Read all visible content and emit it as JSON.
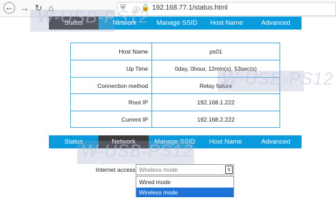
{
  "browser": {
    "url": "192.168.77.1/status.html"
  },
  "watermark": "W-USB-PS12",
  "top_tabs": [
    {
      "label": "Status",
      "active": true
    },
    {
      "label": "Network",
      "active": false
    },
    {
      "label": "Manage SSID",
      "active": false
    },
    {
      "label": "Host Name",
      "active": false
    },
    {
      "label": "Advanced",
      "active": false
    }
  ],
  "status": {
    "rows": [
      {
        "label": "Host Name",
        "value": "ps01"
      },
      {
        "label": "Up Time",
        "value": "0day, 0hour, 12min(s), 53sec(s)"
      },
      {
        "label": "Connection method",
        "value": "Relay failure"
      },
      {
        "label": "Root IP",
        "value": "192.168.1.222"
      },
      {
        "label": "Current IP",
        "value": "192.168.2.222"
      }
    ]
  },
  "bottom_tabs": [
    {
      "label": "Status",
      "active": false
    },
    {
      "label": "Network",
      "active": true
    },
    {
      "label": "Manage SSID",
      "active": false
    },
    {
      "label": "Host Name",
      "active": false
    },
    {
      "label": "Advanced",
      "active": false
    }
  ],
  "network": {
    "internet_access_label": "Internet access",
    "selected": "Wireless mode",
    "options": [
      "Wired mode",
      "Wireless mode"
    ],
    "highlighted_option": "Wireless mode"
  },
  "colors": {
    "tab_bar": "#0a9bdc",
    "tab_active": "#3b3b3b",
    "table_border": "#4aa8e0",
    "option_highlight": "#1e73d6"
  }
}
